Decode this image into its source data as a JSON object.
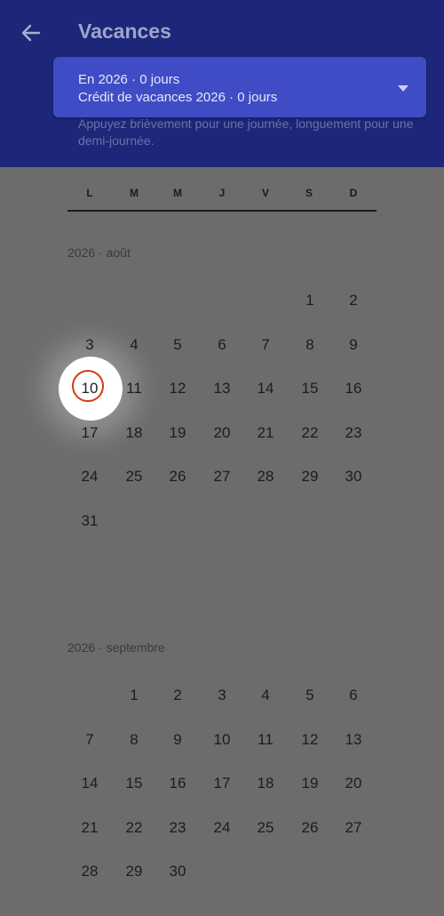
{
  "header": {
    "back_icon": "arrow-left-icon",
    "title": "Vacances",
    "selector": {
      "line1": "En 2026 · 0 jours",
      "line2": "Crédit de vacances 2026 · 0 jours",
      "caret_icon": "dropdown-caret-icon"
    },
    "hint": "Appuyez brièvement pour une journée, longuement pour une demi-journée."
  },
  "weekdays": [
    "L",
    "M",
    "M",
    "J",
    "V",
    "S",
    "D"
  ],
  "months": [
    {
      "label": "2026 · août",
      "weeks": [
        [
          "",
          "",
          "",
          "",
          "",
          "1",
          "2"
        ],
        [
          "3",
          "4",
          "5",
          "6",
          "7",
          "8",
          "9"
        ],
        [
          "10",
          "11",
          "12",
          "13",
          "14",
          "15",
          "16"
        ],
        [
          "17",
          "18",
          "19",
          "20",
          "21",
          "22",
          "23"
        ],
        [
          "24",
          "25",
          "26",
          "27",
          "28",
          "29",
          "30"
        ],
        [
          "31",
          "",
          "",
          "",
          "",
          "",
          ""
        ]
      ],
      "today": "10"
    },
    {
      "label": "2026 · septembre",
      "weeks": [
        [
          "",
          "1",
          "2",
          "3",
          "4",
          "5",
          "6"
        ],
        [
          "7",
          "8",
          "9",
          "10",
          "11",
          "12",
          "13"
        ],
        [
          "14",
          "15",
          "16",
          "17",
          "18",
          "19",
          "20"
        ],
        [
          "21",
          "22",
          "23",
          "24",
          "25",
          "26",
          "27"
        ],
        [
          "28",
          "29",
          "30",
          "",
          "",
          "",
          ""
        ]
      ]
    }
  ],
  "colors": {
    "header_bg": "#1d2679",
    "selector_bg": "#3f4cc6",
    "today_ring": "#d13b12",
    "page_bg": "#6c6c6c"
  }
}
